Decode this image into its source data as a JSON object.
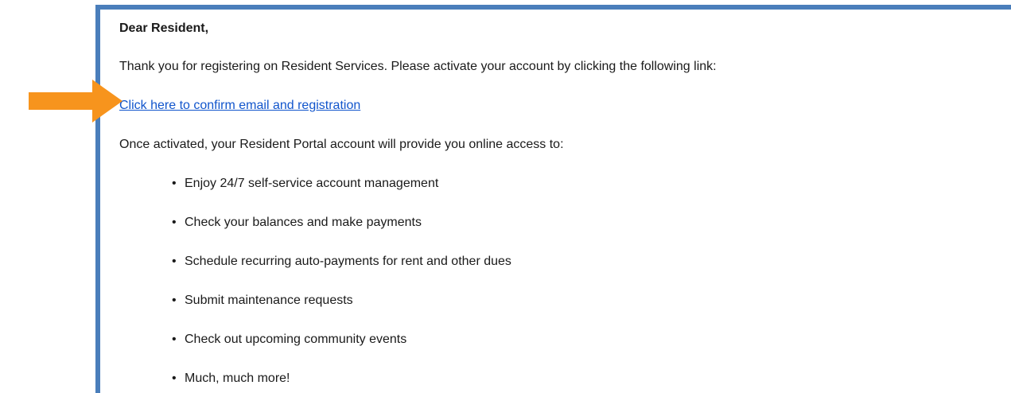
{
  "email": {
    "greeting": "Dear Resident,",
    "intro": "Thank you for registering on Resident Services. Please activate your account by clicking the following link:",
    "confirm_link": "Click here to confirm email and registration",
    "access_intro": "Once activated, your Resident Portal account will provide you online access to:",
    "benefits": [
      "Enjoy 24/7 self-service account management",
      "Check your balances and make payments",
      "Schedule recurring auto-payments for rent and other dues",
      "Submit maintenance requests",
      "Check out upcoming community events",
      "Much, much more!"
    ]
  },
  "icons": {
    "arrow": "arrow-right-icon",
    "bullet": "bullet-icon"
  },
  "colors": {
    "frame_border": "#4a7ebb",
    "link": "#1155cc",
    "arrow": "#f7941d"
  }
}
